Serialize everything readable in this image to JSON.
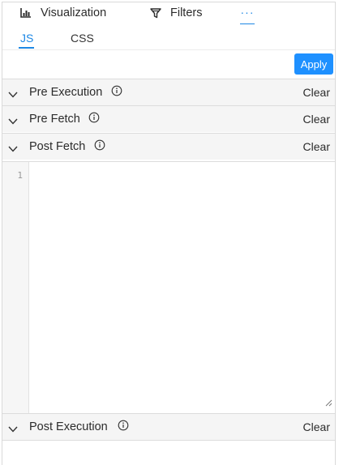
{
  "top_tabs": {
    "visualization": {
      "label": "Visualization",
      "icon": "bar-chart-icon"
    },
    "filters": {
      "label": "Filters",
      "icon": "filter-icon"
    },
    "more": {
      "label": "···",
      "icon": "more-icon"
    }
  },
  "sub_tabs": [
    {
      "label": "JS",
      "active": true
    },
    {
      "label": "CSS",
      "active": false
    }
  ],
  "apply_label": "Apply",
  "sections": [
    {
      "title": "Pre Execution",
      "clear": "Clear",
      "expanded": false
    },
    {
      "title": "Pre Fetch",
      "clear": "Clear",
      "expanded": false
    },
    {
      "title": "Post Fetch",
      "clear": "Clear",
      "expanded": true
    },
    {
      "title": "Post Execution",
      "clear": "Clear",
      "expanded": false
    }
  ],
  "editor": {
    "line_numbers": [
      "1"
    ],
    "content": ""
  },
  "colors": {
    "accent": "#1e88e5",
    "apply_bg": "#1e90ff",
    "section_bg": "#f5f5f5"
  }
}
